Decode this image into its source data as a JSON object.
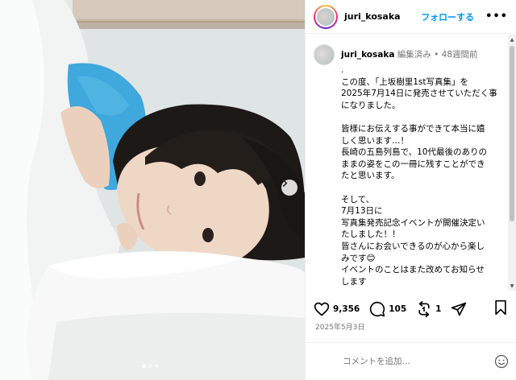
{
  "post": {
    "username": "juri_kosaka",
    "follow_label": "フォローする",
    "more_label": "•••",
    "caption": {
      "username": "juri_kosaka",
      "edited_label": "編集済み",
      "separator": "•",
      "time_ago": "48週間前",
      "text": ".\nこの度、「上坂樹里1st写真集」を\n2025年7月14日に発売させていただく事\nになりました。\n\n皆様にお伝えする事ができて本当に嬉\nしく思います…！\n長崎の五島列島で、10代最後のありの\nままの姿をこの一冊に残すことができ\nたと思います。\n\nそして、\n7月13日に\n写真集発売記念イベントが開催決定い\nたしました！！\n皆さんにお会いできるのが心から楽し\nみです😊\nイベントのことはまた改めてお知らせ\nします\n\nそしてそして、"
    },
    "actions": {
      "likes": "9,356",
      "comments": "105",
      "reposts": "1"
    },
    "date": "2025年5月3日",
    "comment_placeholder": "コメントを追加...",
    "carousel": {
      "count": 3,
      "active_index": 0
    }
  },
  "icons": {
    "like": "heart-icon",
    "comment": "comment-icon",
    "repost": "repost-icon",
    "share": "send-icon",
    "save": "bookmark-icon",
    "emoji": "smiley-icon",
    "next": "chevron-right-icon"
  },
  "colors": {
    "follow": "#0095f6",
    "muted": "#737373",
    "sweater": "#3fa8dc"
  }
}
